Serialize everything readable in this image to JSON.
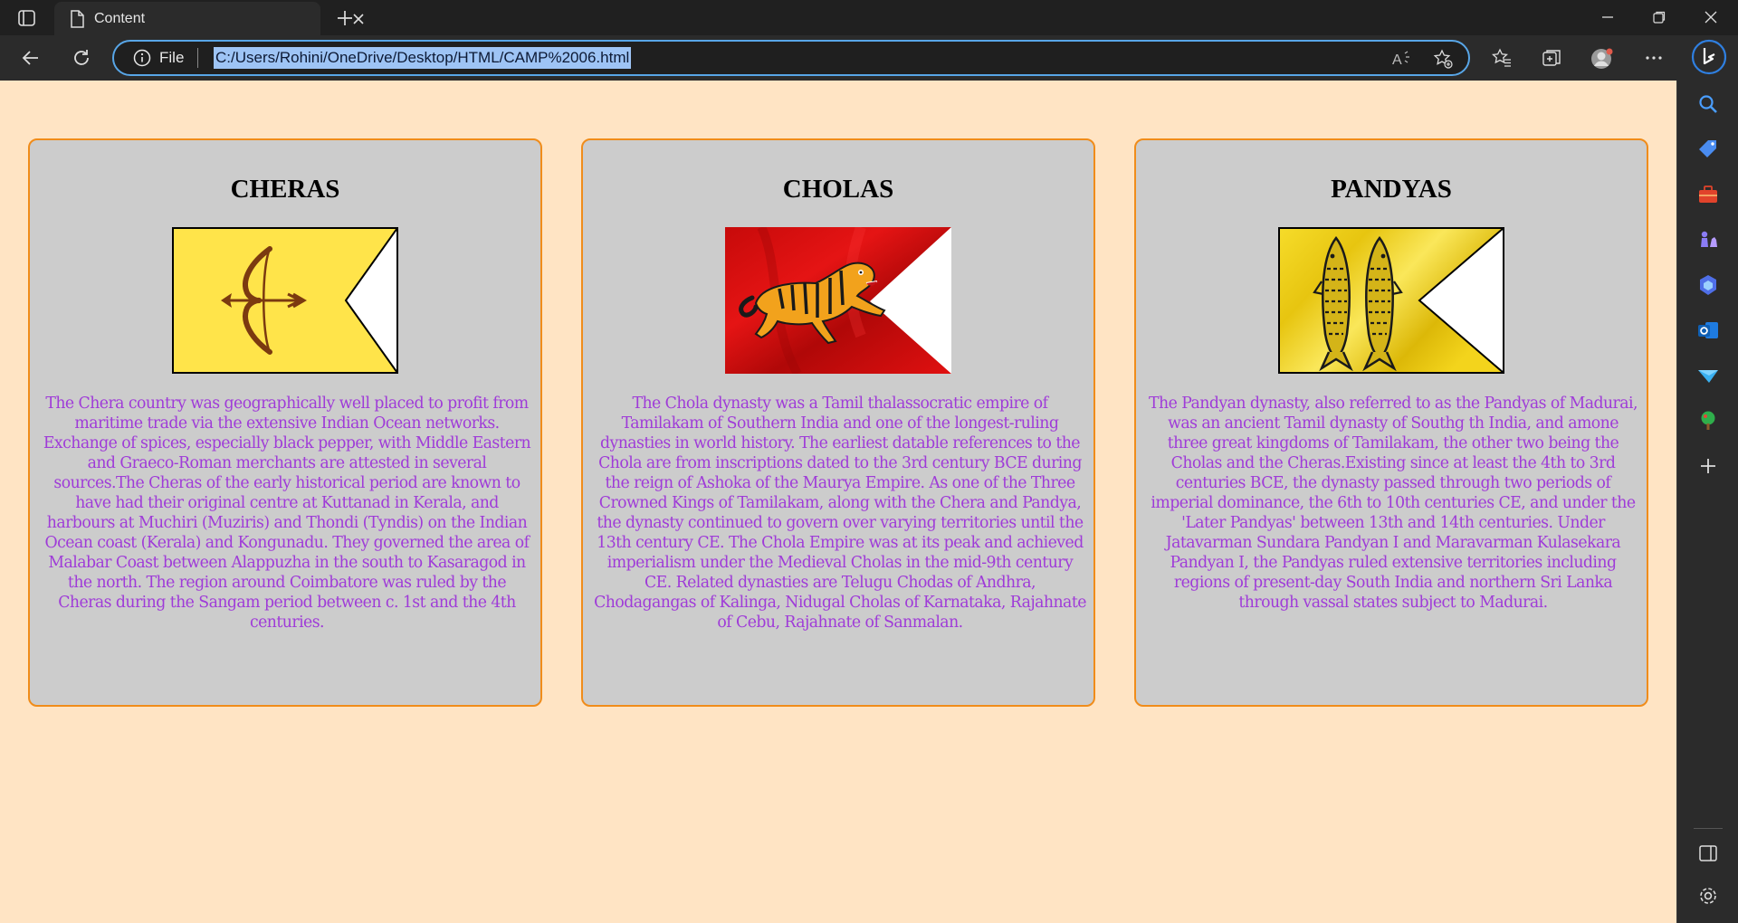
{
  "browser": {
    "tab": {
      "title": "Content"
    },
    "address": {
      "scheme_label": "File",
      "url": "C:/Users/Rohini/OneDrive/Desktop/HTML/CAMP%2006.html"
    }
  },
  "cards": [
    {
      "title": "CHERAS",
      "flag": {
        "field_color": "#ffe44a",
        "emblem": "bow-and-arrow"
      },
      "text": "The Chera country was geographically well placed to profit from maritime trade via the extensive Indian Ocean networks. Exchange of spices, especially black pepper, with Middle Eastern and Graeco-Roman merchants are attested in several sources.The Cheras of the early historical period are known to have had their original centre at Kuttanad in Kerala, and harbours at Muchiri (Muziris) and Thondi (Tyndis) on the Indian Ocean coast (Kerala) and Kongunadu. They governed the area of Malabar Coast between Alappuzha in the south to Kasaragod in the north. The region around Coimbatore was ruled by the Cheras during the Sangam period between c. 1st and the 4th centuries."
    },
    {
      "title": "CHOLAS",
      "flag": {
        "field_color": "#e01010",
        "emblem": "tiger"
      },
      "text": "The Chola dynasty was a Tamil thalassocratic empire of Tamilakam of Southern India and one of the longest-ruling dynasties in world history. The earliest datable references to the Chola are from inscriptions dated to the 3rd century BCE during the reign of Ashoka of the Maurya Empire. As one of the Three Crowned Kings of Tamilakam, along with the Chera and Pandya, the dynasty continued to govern over varying territories until the 13th century CE. The Chola Empire was at its peak and achieved imperialism under the Medieval Cholas in the mid-9th century CE. Related dynasties are Telugu Chodas of Andhra, Chodagangas of Kalinga, Nidugal Cholas of Karnataka, Rajahnate of Cebu, Rajahnate of Sanmalan."
    },
    {
      "title": "PANDYAS",
      "flag": {
        "field_color": "#f2d41c",
        "emblem": "twin-fish"
      },
      "text": "The Pandyan dynasty, also referred to as the Pandyas of Madurai, was an ancient Tamil dynasty of Southg th India, and amone three great kingdoms of Tamilakam, the other two being the Cholas and the Cheras.Existing since at least the 4th to 3rd centuries BCE, the dynasty passed through two periods of imperial dominance, the 6th to 10th centuries CE, and under the 'Later Pandyas' between 13th and 14th centuries. Under Jatavarman Sundara Pandyan I and Maravarman Kulasekara Pandyan I, the Pandyas ruled extensive territories including regions of present-day South India and northern Sri Lanka through vassal states subject to Madurai."
    }
  ],
  "colors": {
    "page_background": "#ffe4c4",
    "card_background": "#cccccc",
    "card_border": "#f08c1a",
    "body_text": "#9f3bd8",
    "url_highlight": "#9ec4f5"
  },
  "sidebar_icons": [
    "search-icon",
    "tag-icon",
    "toolbox-icon",
    "chess-icon",
    "copilot-icon",
    "outlook-icon",
    "send-icon",
    "tree-icon",
    "add-icon",
    "split-screen-icon",
    "settings-icon"
  ]
}
